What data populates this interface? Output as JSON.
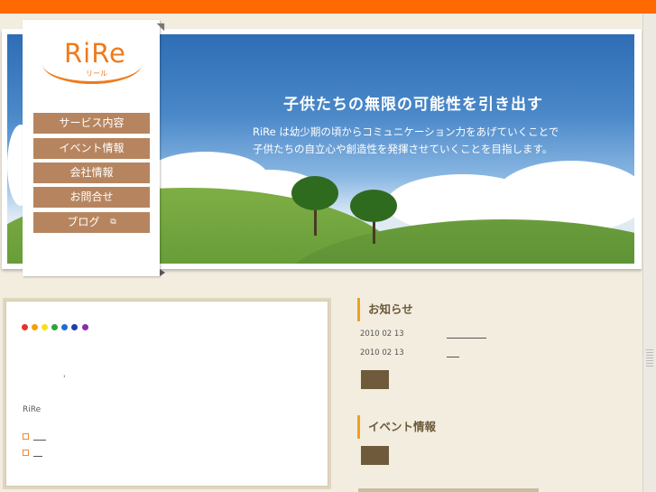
{
  "colors": {
    "topbar": "#ff6a00",
    "nav_button": "#b6855f",
    "logo": "#f07a1a",
    "heading_accent": "#f0a01e",
    "more_button": "#6f5a3c",
    "dots": [
      "#e8312a",
      "#f5a000",
      "#f1e21a",
      "#2aa63c",
      "#1c6fd6",
      "#1f3ea8",
      "#8a2ea8"
    ]
  },
  "logo": {
    "text": "RiRe",
    "subtext": "リール"
  },
  "nav": {
    "items": [
      {
        "label": "サービス内容"
      },
      {
        "label": "イベント情報"
      },
      {
        "label": "会社情報"
      },
      {
        "label": "お問合せ"
      },
      {
        "label": "ブログ",
        "icon": "external-link-icon"
      }
    ]
  },
  "hero": {
    "title": "子供たちの無限の可能性を引き出す",
    "line1": "RiRe は幼少期の頃からコミュニケーション力をあげていくことで",
    "line2": "子供たちの自立心や創造性を発揮させていくことを目指します。"
  },
  "left_box": {
    "tiny_mark": "'",
    "brand": "RiRe"
  },
  "news": {
    "heading": "お知らせ",
    "items": [
      {
        "date": "2010 02 13"
      },
      {
        "date": "2010 02 13"
      }
    ]
  },
  "events": {
    "heading": "イベント情報"
  }
}
